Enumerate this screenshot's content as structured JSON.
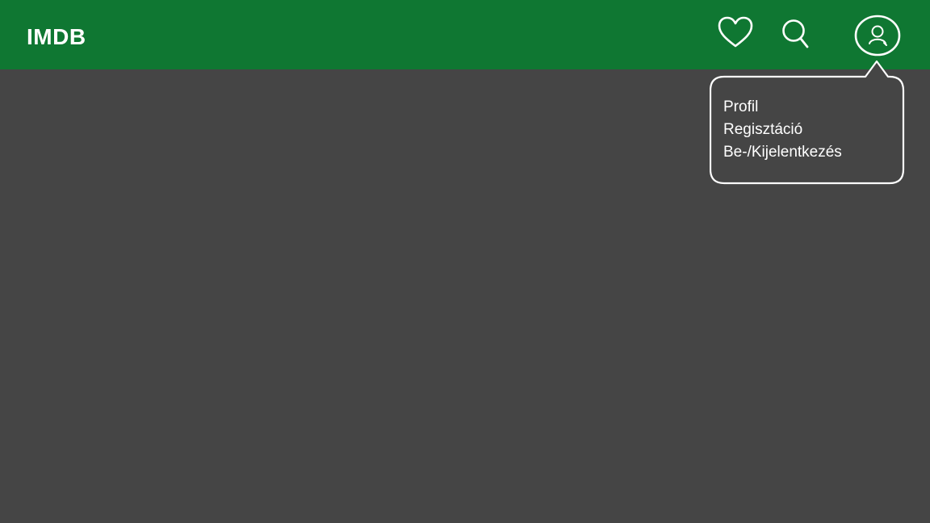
{
  "header": {
    "logo": "IMDB",
    "background": "#0f7732",
    "icons": [
      "heart-icon",
      "search-icon",
      "user-icon"
    ]
  },
  "profile_menu": {
    "items": [
      {
        "label": "Profil"
      },
      {
        "label": "Regisztáció"
      },
      {
        "label": "Be-/Kijelentkezés"
      }
    ]
  },
  "colors": {
    "page_background": "#454545",
    "text": "#ffffff"
  }
}
